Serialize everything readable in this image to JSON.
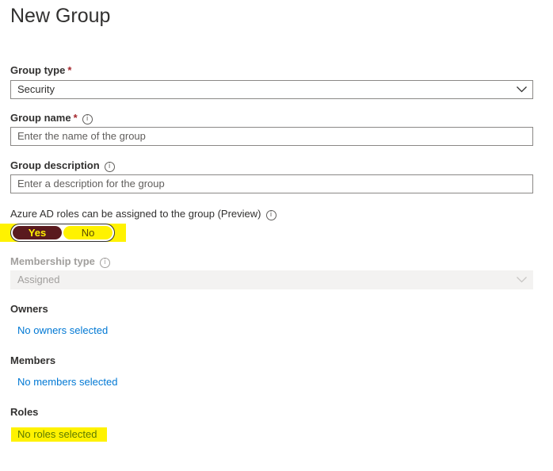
{
  "page": {
    "title": "New Group"
  },
  "group_type": {
    "label": "Group type",
    "required_mark": "*",
    "value": "Security"
  },
  "group_name": {
    "label": "Group name",
    "required_mark": "*",
    "placeholder": "Enter the name of the group"
  },
  "group_description": {
    "label": "Group description",
    "placeholder": "Enter a description for the group"
  },
  "azure_roles": {
    "label": "Azure AD roles can be assigned to the group (Preview)",
    "options": [
      "Yes",
      "No"
    ],
    "selected": "Yes"
  },
  "membership_type": {
    "label": "Membership type",
    "value": "Assigned",
    "disabled": true
  },
  "owners": {
    "label": "Owners",
    "link": "No owners selected"
  },
  "members": {
    "label": "Members",
    "link": "No members selected"
  },
  "roles": {
    "label": "Roles",
    "link": "No roles selected"
  },
  "icons": {
    "info": "info-icon",
    "dropdown": "chevron-down-icon"
  },
  "colors": {
    "highlight": "#fff200",
    "link": "#0078d4",
    "toggle_on": "#5a1a1e",
    "required": "#a4262c"
  }
}
